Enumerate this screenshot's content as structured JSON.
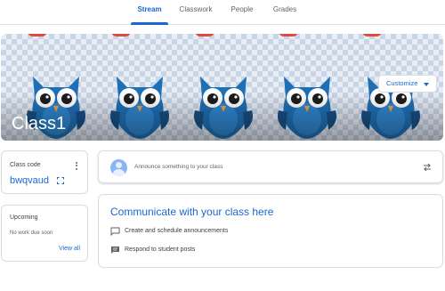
{
  "tabs": [
    {
      "label": "Stream",
      "active": true
    },
    {
      "label": "Classwork",
      "active": false
    },
    {
      "label": "People",
      "active": false
    },
    {
      "label": "Grades",
      "active": false
    }
  ],
  "banner": {
    "title": "Class1",
    "customize_label": "Customize",
    "info_icon": "info-icon",
    "illustration": "owl-icon"
  },
  "class_code": {
    "label": "Class code",
    "value": "bwqvaud",
    "more_icon": "more-vert-icon",
    "expand_icon": "fullscreen-icon"
  },
  "upcoming": {
    "label": "Upcoming",
    "text": "No work due soon",
    "view_all": "View all"
  },
  "announce": {
    "placeholder": "Announce something to your class",
    "repost_icon": "repost-icon"
  },
  "communicate": {
    "title": "Communicate with your class here",
    "items": [
      {
        "label": "Create and schedule announcements",
        "icon": "announcement-icon"
      },
      {
        "label": "Respond to student posts",
        "icon": "comment-icon"
      }
    ]
  },
  "colors": {
    "accent": "#1967d2",
    "owl": "#1f6fb4",
    "border": "#dadce0"
  }
}
